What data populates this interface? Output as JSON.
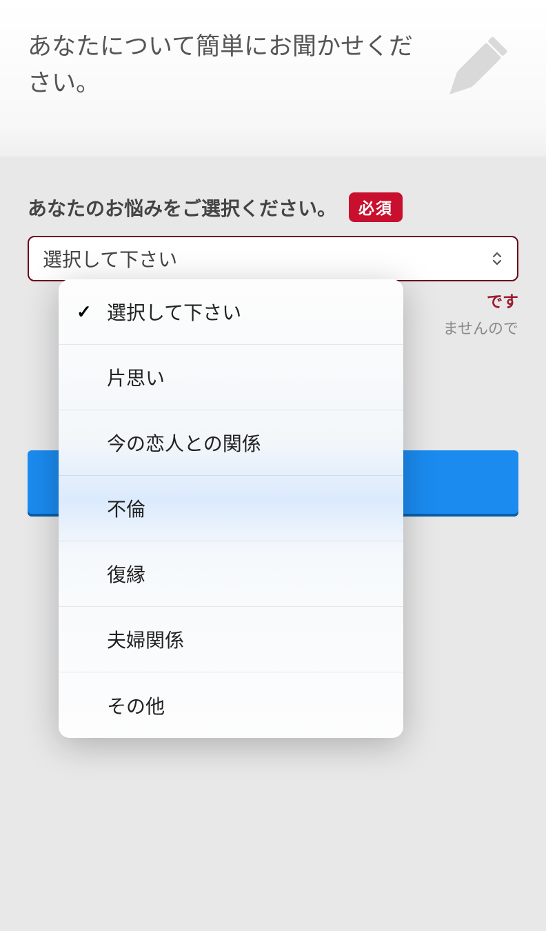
{
  "header": {
    "title": "あなたについて簡単にお聞かせください。"
  },
  "form": {
    "question_label": "あなたのお悩みをご選択ください。",
    "required_badge": "必須",
    "select_value": "選択して下さい",
    "error_suffix": "です",
    "hint_suffix": "ませんので"
  },
  "dropdown": {
    "checkmark": "✓",
    "items": [
      {
        "label": "選択して下さい",
        "selected": true
      },
      {
        "label": "片思い",
        "selected": false
      },
      {
        "label": "今の恋人との関係",
        "selected": false
      },
      {
        "label": "不倫",
        "selected": false
      },
      {
        "label": "復縁",
        "selected": false
      },
      {
        "label": "夫婦関係",
        "selected": false
      },
      {
        "label": "その他",
        "selected": false
      }
    ]
  }
}
